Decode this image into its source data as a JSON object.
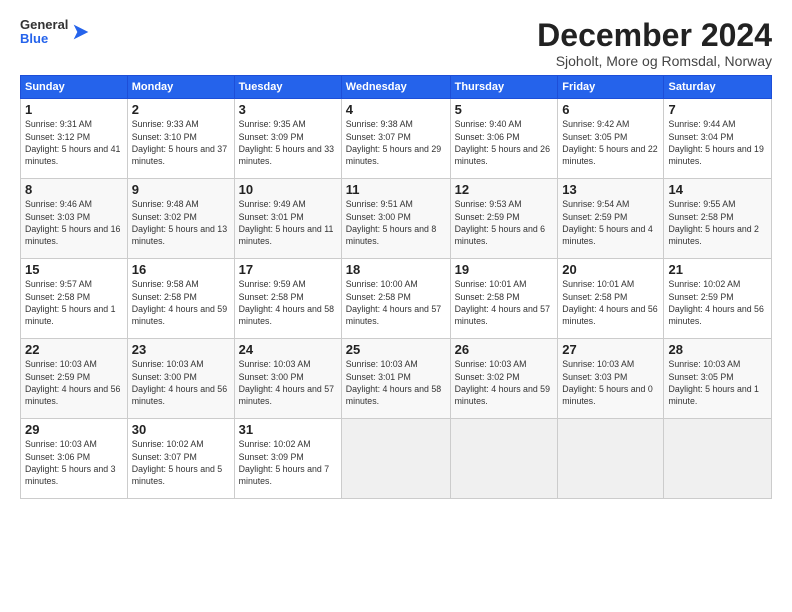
{
  "logo": {
    "general": "General",
    "blue": "Blue"
  },
  "title": "December 2024",
  "subtitle": "Sjoholt, More og Romsdal, Norway",
  "days_of_week": [
    "Sunday",
    "Monday",
    "Tuesday",
    "Wednesday",
    "Thursday",
    "Friday",
    "Saturday"
  ],
  "weeks": [
    [
      {
        "day": "1",
        "sunrise": "9:31 AM",
        "sunset": "3:12 PM",
        "daylight": "5 hours and 41 minutes."
      },
      {
        "day": "2",
        "sunrise": "9:33 AM",
        "sunset": "3:10 PM",
        "daylight": "5 hours and 37 minutes."
      },
      {
        "day": "3",
        "sunrise": "9:35 AM",
        "sunset": "3:09 PM",
        "daylight": "5 hours and 33 minutes."
      },
      {
        "day": "4",
        "sunrise": "9:38 AM",
        "sunset": "3:07 PM",
        "daylight": "5 hours and 29 minutes."
      },
      {
        "day": "5",
        "sunrise": "9:40 AM",
        "sunset": "3:06 PM",
        "daylight": "5 hours and 26 minutes."
      },
      {
        "day": "6",
        "sunrise": "9:42 AM",
        "sunset": "3:05 PM",
        "daylight": "5 hours and 22 minutes."
      },
      {
        "day": "7",
        "sunrise": "9:44 AM",
        "sunset": "3:04 PM",
        "daylight": "5 hours and 19 minutes."
      }
    ],
    [
      {
        "day": "8",
        "sunrise": "9:46 AM",
        "sunset": "3:03 PM",
        "daylight": "5 hours and 16 minutes."
      },
      {
        "day": "9",
        "sunrise": "9:48 AM",
        "sunset": "3:02 PM",
        "daylight": "5 hours and 13 minutes."
      },
      {
        "day": "10",
        "sunrise": "9:49 AM",
        "sunset": "3:01 PM",
        "daylight": "5 hours and 11 minutes."
      },
      {
        "day": "11",
        "sunrise": "9:51 AM",
        "sunset": "3:00 PM",
        "daylight": "5 hours and 8 minutes."
      },
      {
        "day": "12",
        "sunrise": "9:53 AM",
        "sunset": "2:59 PM",
        "daylight": "5 hours and 6 minutes."
      },
      {
        "day": "13",
        "sunrise": "9:54 AM",
        "sunset": "2:59 PM",
        "daylight": "5 hours and 4 minutes."
      },
      {
        "day": "14",
        "sunrise": "9:55 AM",
        "sunset": "2:58 PM",
        "daylight": "5 hours and 2 minutes."
      }
    ],
    [
      {
        "day": "15",
        "sunrise": "9:57 AM",
        "sunset": "2:58 PM",
        "daylight": "5 hours and 1 minute."
      },
      {
        "day": "16",
        "sunrise": "9:58 AM",
        "sunset": "2:58 PM",
        "daylight": "4 hours and 59 minutes."
      },
      {
        "day": "17",
        "sunrise": "9:59 AM",
        "sunset": "2:58 PM",
        "daylight": "4 hours and 58 minutes."
      },
      {
        "day": "18",
        "sunrise": "10:00 AM",
        "sunset": "2:58 PM",
        "daylight": "4 hours and 57 minutes."
      },
      {
        "day": "19",
        "sunrise": "10:01 AM",
        "sunset": "2:58 PM",
        "daylight": "4 hours and 57 minutes."
      },
      {
        "day": "20",
        "sunrise": "10:01 AM",
        "sunset": "2:58 PM",
        "daylight": "4 hours and 56 minutes."
      },
      {
        "day": "21",
        "sunrise": "10:02 AM",
        "sunset": "2:59 PM",
        "daylight": "4 hours and 56 minutes."
      }
    ],
    [
      {
        "day": "22",
        "sunrise": "10:03 AM",
        "sunset": "2:59 PM",
        "daylight": "4 hours and 56 minutes."
      },
      {
        "day": "23",
        "sunrise": "10:03 AM",
        "sunset": "3:00 PM",
        "daylight": "4 hours and 56 minutes."
      },
      {
        "day": "24",
        "sunrise": "10:03 AM",
        "sunset": "3:00 PM",
        "daylight": "4 hours and 57 minutes."
      },
      {
        "day": "25",
        "sunrise": "10:03 AM",
        "sunset": "3:01 PM",
        "daylight": "4 hours and 58 minutes."
      },
      {
        "day": "26",
        "sunrise": "10:03 AM",
        "sunset": "3:02 PM",
        "daylight": "4 hours and 59 minutes."
      },
      {
        "day": "27",
        "sunrise": "10:03 AM",
        "sunset": "3:03 PM",
        "daylight": "5 hours and 0 minutes."
      },
      {
        "day": "28",
        "sunrise": "10:03 AM",
        "sunset": "3:05 PM",
        "daylight": "5 hours and 1 minute."
      }
    ],
    [
      {
        "day": "29",
        "sunrise": "10:03 AM",
        "sunset": "3:06 PM",
        "daylight": "5 hours and 3 minutes."
      },
      {
        "day": "30",
        "sunrise": "10:02 AM",
        "sunset": "3:07 PM",
        "daylight": "5 hours and 5 minutes."
      },
      {
        "day": "31",
        "sunrise": "10:02 AM",
        "sunset": "3:09 PM",
        "daylight": "5 hours and 7 minutes."
      },
      null,
      null,
      null,
      null
    ]
  ],
  "daylight_label": "Daylight:"
}
